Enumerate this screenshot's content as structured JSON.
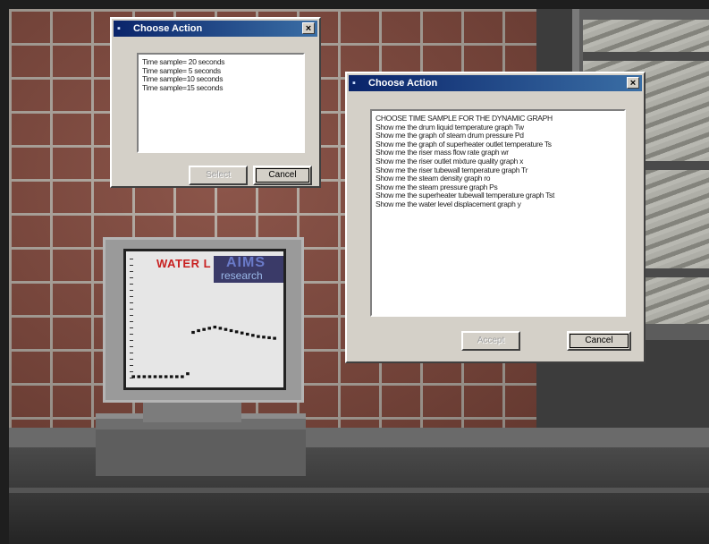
{
  "dialog_small": {
    "title": "Choose Action",
    "items": [
      "Time sample= 20 seconds",
      "Time sample= 5 seconds",
      "Time sample=10 seconds",
      "Time sample=15 seconds"
    ],
    "ok_label": "Select",
    "cancel_label": "Cancel"
  },
  "dialog_large": {
    "title": "Choose Action",
    "items": [
      "CHOOSE TIME SAMPLE FOR THE DYNAMIC GRAPH",
      "Show me the drum liquid temperature graph Tw",
      "Show me the graph of steam drum pressure Pd",
      "Show me the graph of superheater outlet temperature Ts",
      "Show me the riser mass flow rate graph wr",
      "Show me the riser outlet mixture quality graph x",
      "Show me the riser tubewall temperature graph Tr",
      "Show me the steam density graph ro",
      "Show me the steam pressure graph Ps",
      "Show me the superheater tubewall temperature graph Tst",
      "Show me the water level displacement graph y"
    ],
    "ok_label": "Accept",
    "cancel_label": "Cancel"
  },
  "monitor": {
    "title": "WATER L",
    "logo_main": "AIMS",
    "logo_sub": "research"
  },
  "chart_data": {
    "type": "scatter",
    "title": "",
    "xlabel": "",
    "ylabel": "",
    "series": [
      {
        "x": [
          0,
          1,
          2,
          3,
          4,
          5,
          6,
          7,
          8,
          9,
          10,
          11,
          12,
          13,
          14,
          15,
          16,
          17,
          18,
          19,
          20,
          21,
          22,
          23,
          24,
          25,
          26
        ],
        "y": [
          0,
          0,
          0,
          0,
          0,
          0,
          0,
          0,
          0,
          0,
          0.5,
          7.5,
          7.8,
          8.0,
          8.2,
          8.4,
          8.2,
          8.0,
          7.8,
          7.6,
          7.4,
          7.2,
          7.0,
          6.8,
          6.7,
          6.6,
          6.5
        ]
      }
    ],
    "xlim": [
      0,
      27
    ],
    "ylim": [
      0,
      20
    ]
  },
  "colors": {
    "titlebar_start": "#0a246a",
    "titlebar_end": "#3a6ea5",
    "dialog_face": "#d4d0c8",
    "monitor_title": "#c82020"
  },
  "icons": {
    "window_icon": "window-icon",
    "close_icon": "close-icon"
  }
}
